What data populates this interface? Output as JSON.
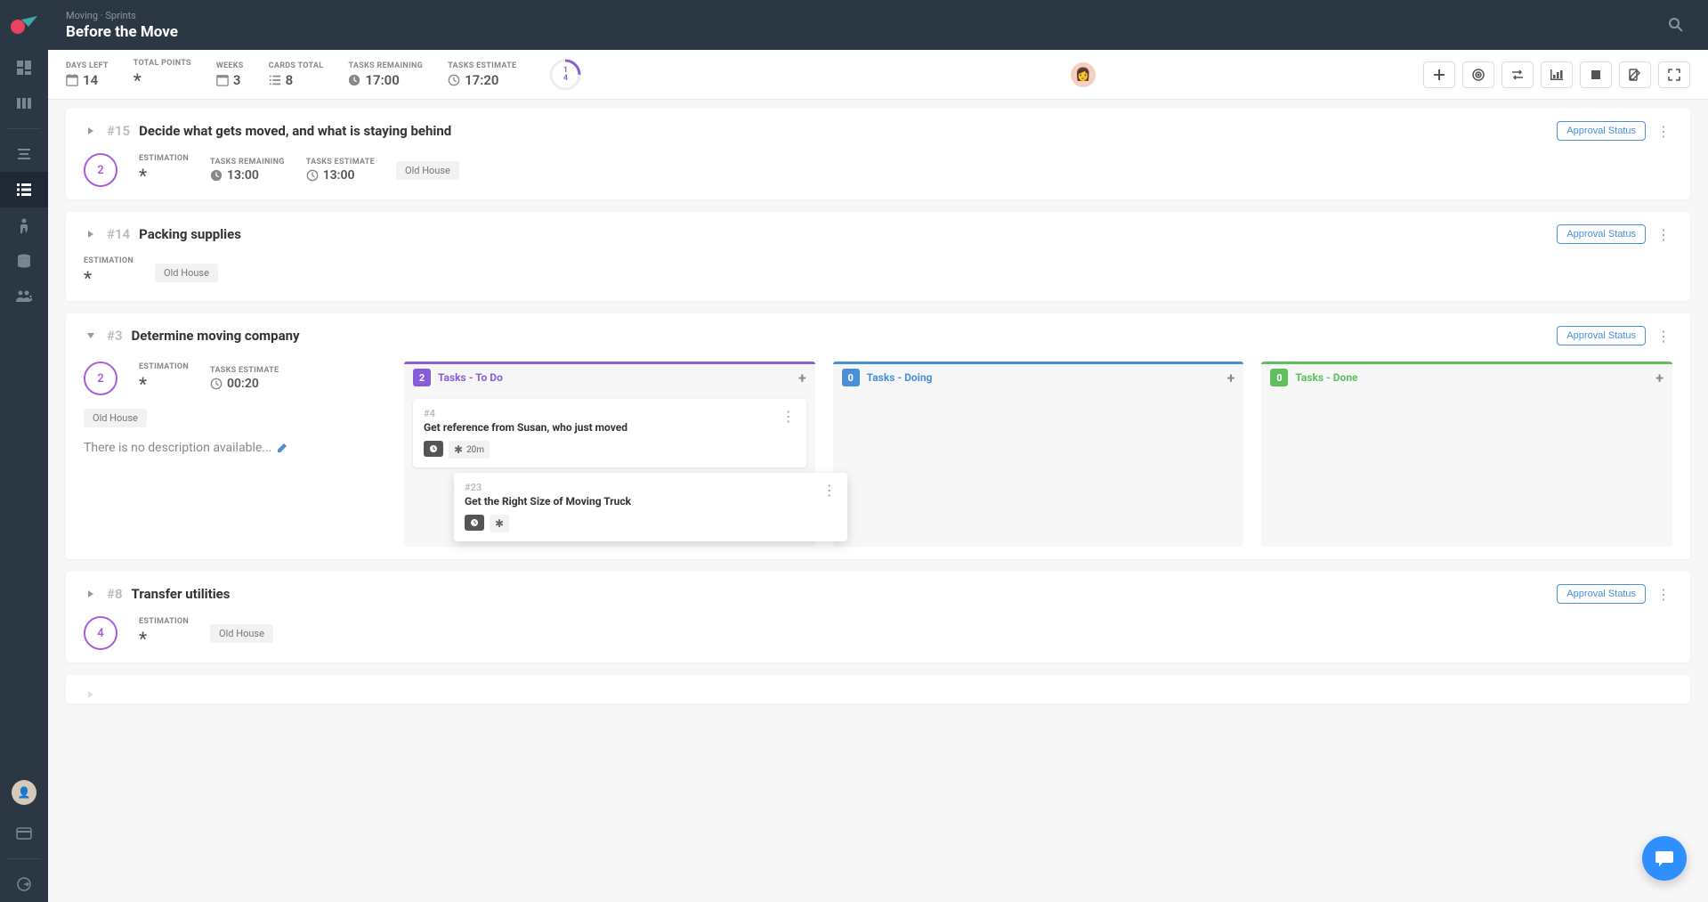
{
  "breadcrumb": "Moving · Sprints",
  "page_title": "Before the Move",
  "stats": {
    "days_left_label": "DAYS LEFT",
    "days_left": "14",
    "total_points_label": "TOTAL POINTS",
    "total_points": "*",
    "weeks_label": "WEEKS",
    "weeks": "3",
    "cards_total_label": "CARDS TOTAL",
    "cards_total": "8",
    "tasks_remaining_label": "TASKS REMAINING",
    "tasks_remaining": "17:00",
    "tasks_estimate_label": "TASKS ESTIMATE",
    "tasks_estimate": "17:20",
    "ring_top": "1",
    "ring_bottom": "4"
  },
  "approval_label": "Approval Status",
  "cards": [
    {
      "id": "#15",
      "title": "Decide what gets moved, and what is staying behind",
      "points": "2",
      "estimation_label": "ESTIMATION",
      "estimation": "*",
      "tasks_remaining_label": "TASKS REMAINING",
      "tasks_remaining": "13:00",
      "tasks_estimate_label": "TASKS ESTIMATE",
      "tasks_estimate": "13:00",
      "tag": "Old House"
    },
    {
      "id": "#14",
      "title": "Packing supplies",
      "estimation_label": "ESTIMATION",
      "estimation": "*",
      "tag": "Old House"
    },
    {
      "id": "#3",
      "title": "Determine moving company",
      "points": "2",
      "estimation_label": "ESTIMATION",
      "estimation": "*",
      "tasks_estimate_label": "TASKS ESTIMATE",
      "tasks_estimate": "00:20",
      "tag": "Old House",
      "description": "There is no description available...",
      "columns": {
        "todo": {
          "count": "2",
          "title": "Tasks - To Do"
        },
        "doing": {
          "count": "0",
          "title": "Tasks - Doing"
        },
        "done": {
          "count": "0",
          "title": "Tasks - Done"
        }
      },
      "tasks": [
        {
          "id": "#4",
          "title": "Get reference from Susan, who just moved",
          "time": "20m"
        },
        {
          "id": "#23",
          "title": "Get the Right Size of Moving Truck"
        }
      ]
    },
    {
      "id": "#8",
      "title": "Transfer utilities",
      "points": "4",
      "estimation_label": "ESTIMATION",
      "estimation": "*",
      "tag": "Old House"
    }
  ]
}
